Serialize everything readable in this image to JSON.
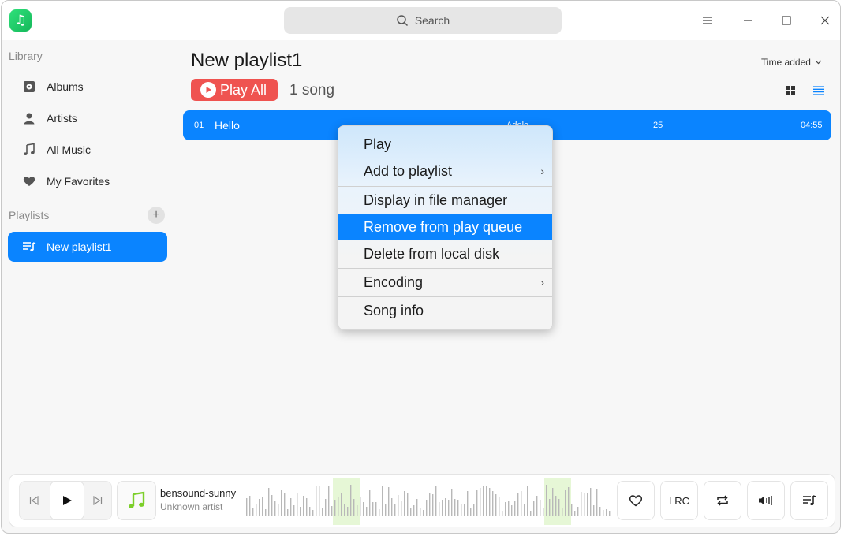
{
  "window": {
    "search_placeholder": "Search"
  },
  "sidebar": {
    "library_label": "Library",
    "items": [
      {
        "label": "Albums",
        "icon": "album-icon"
      },
      {
        "label": "Artists",
        "icon": "artist-icon"
      },
      {
        "label": "All Music",
        "icon": "music-note-icon"
      },
      {
        "label": "My Favorites",
        "icon": "heart-icon"
      }
    ],
    "playlists_label": "Playlists",
    "add_playlist": "+",
    "playlists": [
      {
        "label": "New playlist1",
        "icon": "playlist-icon",
        "active": true
      }
    ]
  },
  "main": {
    "title": "New playlist1",
    "sort_label": "Time added",
    "play_all_label": "Play All",
    "song_count": "1 song",
    "songs": [
      {
        "num": "01",
        "title": "Hello",
        "artist": "Adele",
        "album": "25",
        "duration": "04:55"
      }
    ]
  },
  "context_menu": {
    "items": [
      {
        "label": "Play",
        "submenu": false
      },
      {
        "label": "Add to playlist",
        "submenu": true
      },
      {
        "label": "Display in file manager",
        "submenu": false
      },
      {
        "label": "Remove from play queue",
        "submenu": false,
        "highlighted": true
      },
      {
        "label": "Delete from local disk",
        "submenu": false
      },
      {
        "label": "Encoding",
        "submenu": true
      },
      {
        "label": "Song info",
        "submenu": false
      }
    ],
    "submenu_arrow": "›"
  },
  "player": {
    "track_title": "bensound-sunny",
    "track_artist": "Unknown artist",
    "lyrics_label": "LRC"
  },
  "colors": {
    "accent": "#0a84ff",
    "play_all": "#ef5350",
    "logo": "#1fcf6a"
  }
}
